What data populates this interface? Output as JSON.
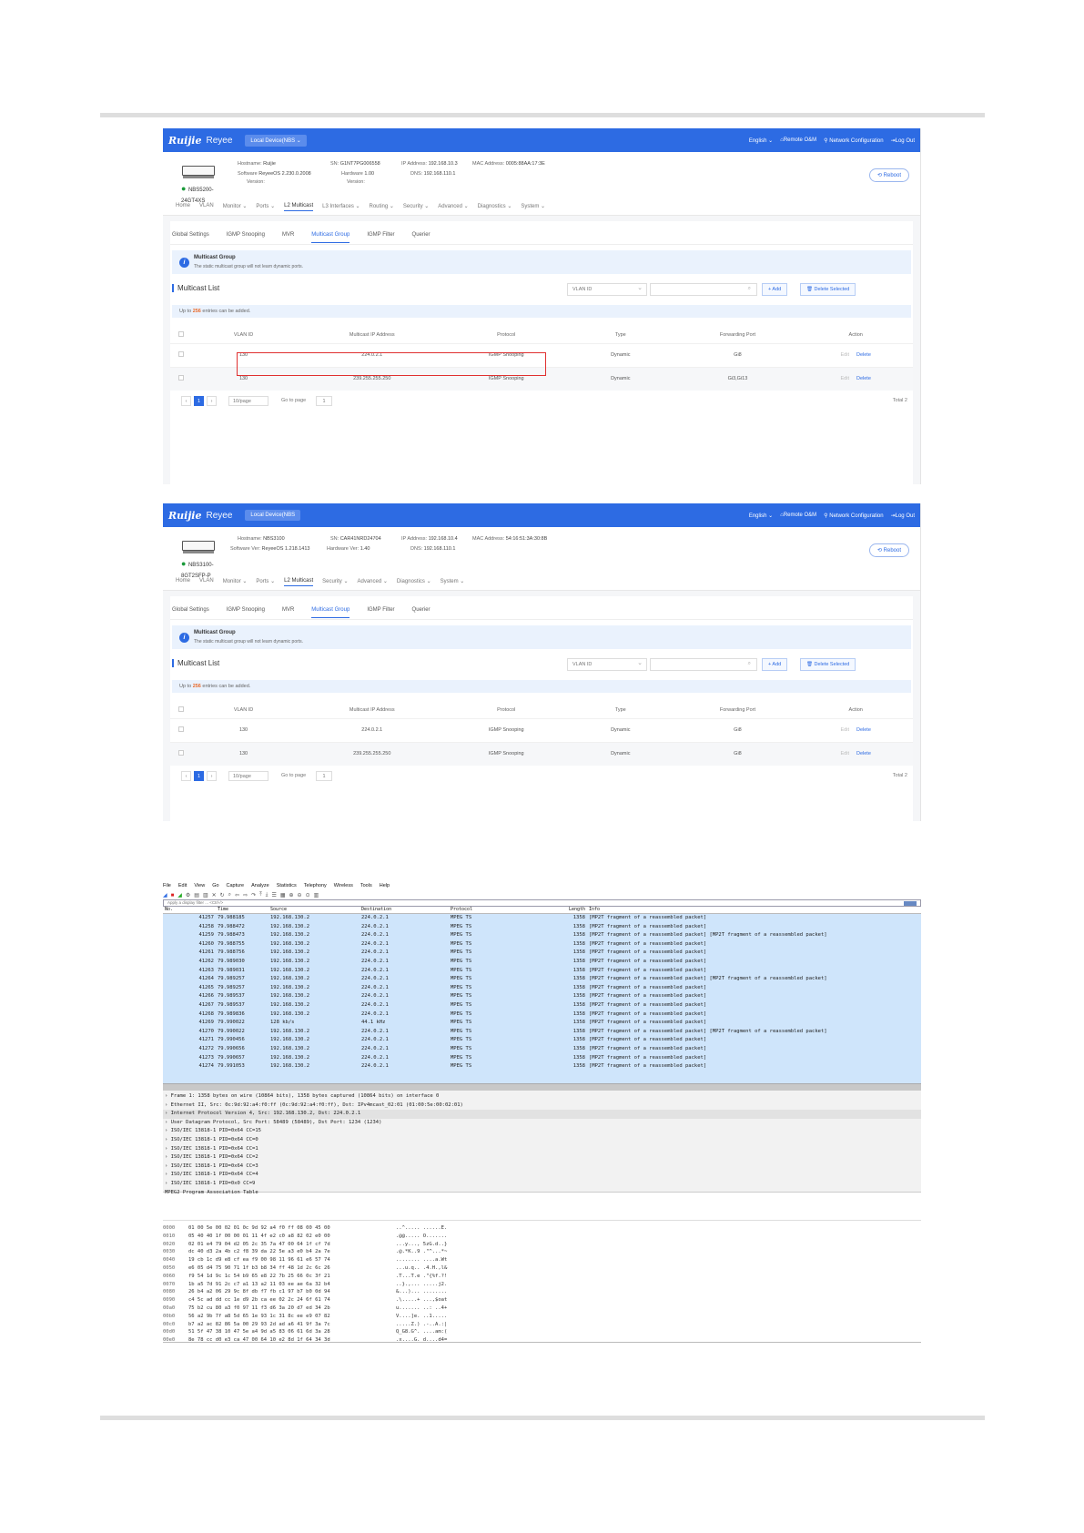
{
  "screenshots": [
    {
      "topbar": {
        "brand": "Ruijie",
        "brand2": "Reyee",
        "device_select": "Local Device(NBS ⌄",
        "language": "English ⌄",
        "remote": "Remote O&M",
        "network_config": "Network Configuration",
        "logout": "Log Out"
      },
      "device": {
        "model": "NBS5200-24GT4XS",
        "model_line1": "NBS5200-",
        "model_line2": "24GT4XS",
        "hostname_label": "Hostname:",
        "hostname": "Ruijie",
        "software_label": "Software",
        "software_label2": "Version:",
        "software": "ReyeeOS 2.230.0.2008",
        "sn_label": "SN:",
        "sn": "G1NT7PG006558",
        "hardware_label": "Hardware",
        "hardware_label2": "Version:",
        "hardware": "1.00",
        "ip_label": "IP Address:",
        "ip": "192.168.10.3",
        "dns_label": "DNS:",
        "dns": "192.168.110.1",
        "mac_label": "MAC Address:",
        "mac": "0005:88AA:17:3E",
        "reboot": "Reboot"
      },
      "nav": [
        "Home",
        "VLAN",
        "Monitor ⌄",
        "Ports ⌄",
        "L2 Multicast",
        "L3 Interfaces ⌄",
        "Routing ⌄",
        "Security ⌄",
        "Advanced ⌄",
        "Diagnostics ⌄",
        "System ⌄"
      ],
      "nav_active": 4,
      "tabs": [
        "Global Settings",
        "IGMP Snooping",
        "MVR",
        "Multicast Group",
        "IGMP Filter",
        "Querier"
      ],
      "tab_active": 3,
      "info_title": "Multicast Group",
      "info_text": "The static multicast group will not learn dynamic ports.",
      "list_title": "Multicast List",
      "vlan_select": "VLAN ID",
      "add_btn": "+ Add",
      "delete_btn": "Delete Selected",
      "limit_prefix": "Up to",
      "limit_num": "256",
      "limit_suffix": "entries can be added.",
      "columns": [
        "VLAN ID",
        "Multicast IP Address",
        "Protocol",
        "Type",
        "Forwarding Port",
        "Action"
      ],
      "rows": [
        {
          "vlan": "130",
          "ip": "224.0.2.1",
          "protocol": "IGMP Snooping",
          "type": "Dynamic",
          "port": "Gi8",
          "edit": "Edit",
          "delete": "Delete"
        },
        {
          "vlan": "130",
          "ip": "239.255.255.250",
          "protocol": "IGMP Snooping",
          "type": "Dynamic",
          "port": "Gi3,Gi13",
          "edit": "Edit",
          "delete": "Delete"
        }
      ],
      "pager": {
        "page": "1",
        "page_size": "10/page",
        "goto_label": "Go to page",
        "goto_value": "1",
        "total": "Total 2"
      }
    },
    {
      "topbar": {
        "brand": "Ruijie",
        "brand2": "Reyee",
        "device_select": "Local Device(NBS",
        "language": "English ⌄",
        "remote": "Remote O&M",
        "network_config": "Network Configuration",
        "logout": "Log Out"
      },
      "device": {
        "model": "NBS3100-8GT2SFP-P",
        "model_line1": "NBS3100-",
        "model_line2": "8GT2SFP-P",
        "hostname_label": "Hostname:",
        "hostname": "NBS3100",
        "software_label": "Software Ver:",
        "software_label2": "",
        "software": "ReyeeOS 1.218.1413",
        "sn_label": "SN:",
        "sn": "CAR41NRD24704",
        "hardware_label": "Hardware Ver:",
        "hardware_label2": "",
        "hardware": "1.40",
        "ip_label": "IP Address:",
        "ip": "192.168.10.4",
        "dns_label": "DNS:",
        "dns": "192.168.110.1",
        "mac_label": "MAC Address:",
        "mac": "54:16:51:3A:30:8B",
        "reboot": "Reboot"
      },
      "nav": [
        "Home",
        "VLAN",
        "Monitor ⌄",
        "Ports ⌄",
        "L2 Multicast",
        "Security ⌄",
        "Advanced ⌄",
        "Diagnostics ⌄",
        "System ⌄"
      ],
      "nav_active": 4,
      "tabs": [
        "Global Settings",
        "IGMP Snooping",
        "MVR",
        "Multicast Group",
        "IGMP Filter",
        "Querier"
      ],
      "tab_active": 3,
      "info_title": "Multicast Group",
      "info_text": "The static multicast group will not learn dynamic ports.",
      "list_title": "Multicast List",
      "vlan_select": "VLAN ID",
      "add_btn": "+ Add",
      "delete_btn": "Delete Selected",
      "limit_prefix": "Up to",
      "limit_num": "256",
      "limit_suffix": "entries can be added.",
      "columns": [
        "VLAN ID",
        "Multicast IP Address",
        "Protocol",
        "Type",
        "Forwarding Port",
        "Action"
      ],
      "rows": [
        {
          "vlan": "130",
          "ip": "224.0.2.1",
          "protocol": "IGMP Snooping",
          "type": "Dynamic",
          "port": "Gi8",
          "edit": "Edit",
          "delete": "Delete"
        },
        {
          "vlan": "130",
          "ip": "239.255.255.250",
          "protocol": "IGMP Snooping",
          "type": "Dynamic",
          "port": "Gi8",
          "edit": "Edit",
          "delete": "Delete"
        }
      ],
      "pager": {
        "page": "1",
        "page_size": "10/page",
        "goto_label": "Go to page",
        "goto_value": "1",
        "total": "Total 2"
      }
    }
  ],
  "wireshark": {
    "menu": [
      "File",
      "Edit",
      "View",
      "Go",
      "Capture",
      "Analyze",
      "Statistics",
      "Telephony",
      "Wireless",
      "Tools",
      "Help"
    ],
    "filter_placeholder": "Apply a display filter ... <Ctrl-/>",
    "columns": [
      "No.",
      "Time",
      "Source",
      "Destination",
      "Protocol",
      "Length",
      "Info"
    ],
    "packets": [
      [
        "41257",
        "79.988185",
        "192.168.130.2",
        "224.0.2.1",
        "MPEG TS",
        "1358",
        "[MP2T fragment of a reassembled packet]"
      ],
      [
        "41258",
        "79.988472",
        "192.168.130.2",
        "224.0.2.1",
        "MPEG TS",
        "1358",
        "[MP2T fragment of a reassembled packet]"
      ],
      [
        "41259",
        "79.988473",
        "192.168.130.2",
        "224.0.2.1",
        "MPEG TS",
        "1358",
        "[MP2T fragment of a reassembled packet] [MP2T fragment of a reassembled packet]"
      ],
      [
        "41260",
        "79.988755",
        "192.168.130.2",
        "224.0.2.1",
        "MPEG TS",
        "1358",
        "[MP2T fragment of a reassembled packet]"
      ],
      [
        "41261",
        "79.988756",
        "192.168.130.2",
        "224.0.2.1",
        "MPEG TS",
        "1358",
        "[MP2T fragment of a reassembled packet]"
      ],
      [
        "41262",
        "79.989030",
        "192.168.130.2",
        "224.0.2.1",
        "MPEG TS",
        "1358",
        "[MP2T fragment of a reassembled packet]"
      ],
      [
        "41263",
        "79.989031",
        "192.168.130.2",
        "224.0.2.1",
        "MPEG TS",
        "1358",
        "[MP2T fragment of a reassembled packet]"
      ],
      [
        "41264",
        "79.989257",
        "192.168.130.2",
        "224.0.2.1",
        "MPEG TS",
        "1358",
        "[MP2T fragment of a reassembled packet] [MP2T fragment of a reassembled packet]"
      ],
      [
        "41265",
        "79.989257",
        "192.168.130.2",
        "224.0.2.1",
        "MPEG TS",
        "1358",
        "[MP2T fragment of a reassembled packet]"
      ],
      [
        "41266",
        "79.989537",
        "192.168.130.2",
        "224.0.2.1",
        "MPEG TS",
        "1358",
        "[MP2T fragment of a reassembled packet]"
      ],
      [
        "41267",
        "79.989537",
        "192.168.130.2",
        "224.0.2.1",
        "MPEG TS",
        "1358",
        "[MP2T fragment of a reassembled packet]"
      ],
      [
        "41268",
        "79.989836",
        "192.168.130.2",
        "224.0.2.1",
        "MPEG TS",
        "1358",
        "[MP2T fragment of a reassembled packet]"
      ],
      [
        "41269",
        "79.990022",
        "128 kb/s",
        "44.1 kHz",
        "MPEG TS",
        "1358",
        "[MP2T fragment of a reassembled packet]"
      ],
      [
        "41270",
        "79.990022",
        "192.168.130.2",
        "224.0.2.1",
        "MPEG TS",
        "1358",
        "[MP2T fragment of a reassembled packet] [MP2T fragment of a reassembled packet]"
      ],
      [
        "41271",
        "79.990456",
        "192.168.130.2",
        "224.0.2.1",
        "MPEG TS",
        "1358",
        "[MP2T fragment of a reassembled packet]"
      ],
      [
        "41272",
        "79.990656",
        "192.168.130.2",
        "224.0.2.1",
        "MPEG TS",
        "1358",
        "[MP2T fragment of a reassembled packet]"
      ],
      [
        "41273",
        "79.990657",
        "192.168.130.2",
        "224.0.2.1",
        "MPEG TS",
        "1358",
        "[MP2T fragment of a reassembled packet]"
      ],
      [
        "41274",
        "79.991053",
        "192.168.130.2",
        "224.0.2.1",
        "MPEG TS",
        "1358",
        "[MP2T fragment of a reassembled packet]"
      ]
    ],
    "details": [
      "› Frame 1: 1358 bytes on wire (10864 bits), 1358 bytes captured (10864 bits) on interface 0",
      "› Ethernet II, Src: 0c:9d:92:a4:f0:ff (0c:9d:92:a4:f0:ff), Dst: IPv4mcast_02:01 (01:00:5e:00:02:01)",
      "› Internet Protocol Version 4, Src: 192.168.130.2, Dst: 224.0.2.1",
      "› User Datagram Protocol, Src Port: 58489 (58489), Dst Port: 1234 (1234)",
      "› ISO/IEC 13818-1 PID=0x64 CC=15",
      "› ISO/IEC 13818-1 PID=0x64 CC=0",
      "› ISO/IEC 13818-1 PID=0x64 CC=1",
      "› ISO/IEC 13818-1 PID=0x64 CC=2",
      "› ISO/IEC 13818-1 PID=0x64 CC=3",
      "› ISO/IEC 13818-1 PID=0x64 CC=4",
      "› ISO/IEC 13818-1 PID=0x0 CC=9",
      "  MPEG2 Program Association Table"
    ],
    "hex": [
      [
        "0000",
        "01 00 5e 00 02 01 0c 9d  92 a4 f0 ff 08 00 45 00",
        "..^..... ......E."
      ],
      [
        "0010",
        "05 40 40 1f 00 00 01 11  4f e2 c0 a8 82 02 e0 00",
        ".@@..... O......."
      ],
      [
        "0020",
        "02 01 e4 79 04 d2 05 2c  35 7a 47 00 64 1f cf 7d",
        "...y..., 5zG.d..}"
      ],
      [
        "0030",
        "dc 40 d3 2a 4b c2 f8 39  da 22 5e a3 e0 b4 2a 7e",
        ".@.*K..9 .\"^...*~"
      ],
      [
        "0040",
        "19 cb 1c d9 e8 cf ea f9  00 98 11 96 61 e6 57 74",
        "........ ....a.Wt"
      ],
      [
        "0050",
        "e6 05 d4 75 90 71 1f b3  b8 34 ff 48 1d 2c 6c 26",
        "...u.q.. .4.H.,l&"
      ],
      [
        "0060",
        "f9 54 1d 9c 1c 54 b9 65  e8 22 7b 25 66 0c 3f 21",
        ".T...T.e .\"{%f.?!"
      ],
      [
        "0070",
        "1b a5 7d 91 2c c7 a1 13  a2 11 03 ee ae 6a 32 b4",
        "..}.,... .....j2."
      ],
      [
        "0080",
        "26 b4 a2 06 29 9c 8f db  f7 fb c1 97 b7 b0 0d 94",
        "&...)... ........"
      ],
      [
        "0090",
        "c4 5c ad dd cc 1e d9 2b  ca ee 02 2c 24 6f 61 74",
        ".\\.....+ ...,$oat"
      ],
      [
        "00a0",
        "75 b2 cu 80 a3 f0 97 11  f3 d6 3a 20 d7 ed 34 2b",
        "u....... ..: ..4+"
      ],
      [
        "00b0",
        "56 a2 9b 7f a8 5d 65 1e  93 1c 31 8c ee e9 07 82",
        "V....]e. ..1....."
      ],
      [
        "00c0",
        "b7 a2 ac 82 86 5a 00 29  93 2d ad a6 41 9f 3a 7c",
        ".....Z.) .-..A.:|"
      ],
      [
        "00d0",
        "51 5f 47 38 10 47 5e a4  9d a5 83 06 61 6d 3a 28",
        "Q_G8.G^. ....am:("
      ],
      [
        "00e0",
        "8e 78 cc d0 e3 ca 47 00  64 10 e2 8d 1f 64 34 3d",
        ".x....G. d....d4="
      ]
    ]
  }
}
